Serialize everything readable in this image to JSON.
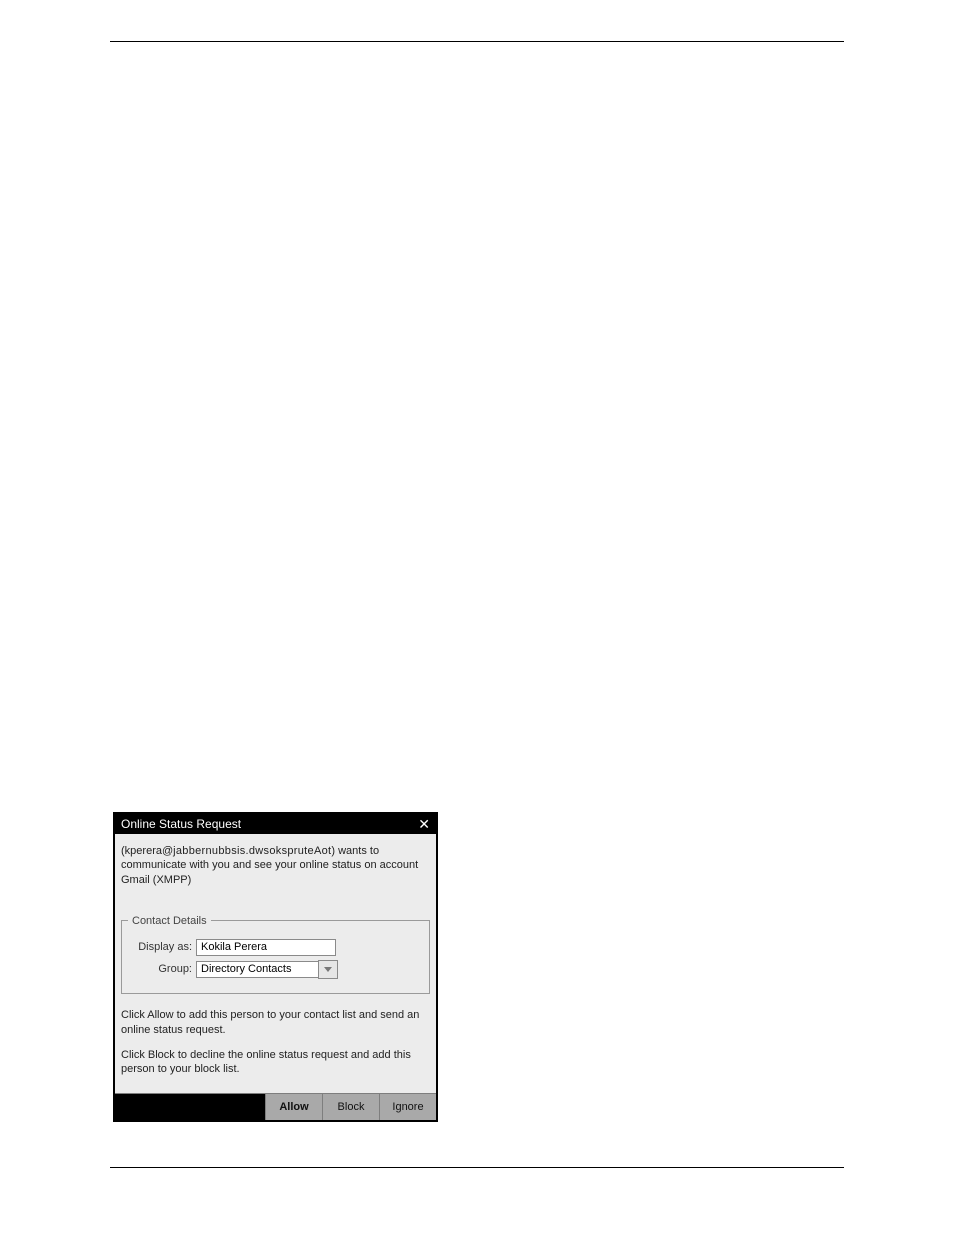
{
  "dialog": {
    "title": "Online Status Request",
    "requester_prefix": "kperera@",
    "requester_obfuscated": "jabbernubbsis.dwsokspruteAot",
    "message_line1_rest": " wants to",
    "message_line2": "communicate with you and see your online status on account",
    "account_label": "Gmail (XMPP)",
    "contact_details": {
      "legend": "Contact Details",
      "display_as_label": "Display as:",
      "display_as_value": "Kokila Perera",
      "group_label": "Group:",
      "group_value": "Directory Contacts"
    },
    "hints": {
      "allow": "Click Allow to add this person to your contact list and send an online status request.",
      "block": "Click Block to decline the online status request and add this person to your block list."
    },
    "buttons": {
      "allow": "Allow",
      "block": "Block",
      "ignore": "Ignore"
    }
  }
}
